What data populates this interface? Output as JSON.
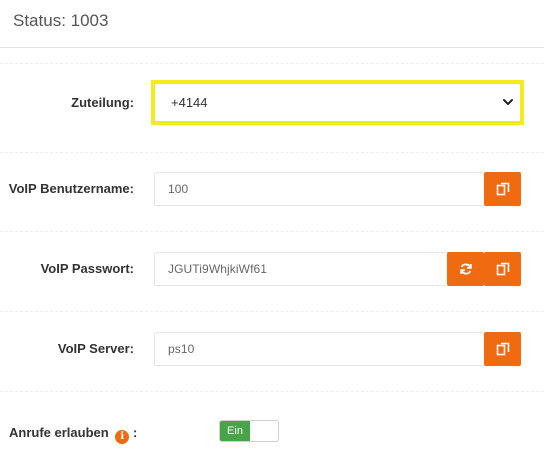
{
  "header": {
    "title": "Status: 1003"
  },
  "form": {
    "assignment": {
      "label": "Zuteilung:",
      "value": "+4144"
    },
    "voip_username": {
      "label": "VoIP Benutzername:",
      "value": "100"
    },
    "voip_password": {
      "label": "VoIP Passwort:",
      "value": "JGUTi9WhjkiWf61"
    },
    "voip_server": {
      "label": "VoIP Server:",
      "value": "ps10"
    },
    "allow_calls": {
      "label": "Anrufe erlauben",
      "suffix": ":",
      "info_glyph": "i",
      "toggle_label": "Ein",
      "enabled": true
    }
  },
  "icons": {
    "copy": "copy-icon",
    "refresh": "refresh-icon",
    "info": "info-icon",
    "dropdown": "chevron-down-icon"
  },
  "colors": {
    "accent": "#f06a0f",
    "highlight": "#f3ec1a",
    "toggle_on": "#47a447"
  }
}
